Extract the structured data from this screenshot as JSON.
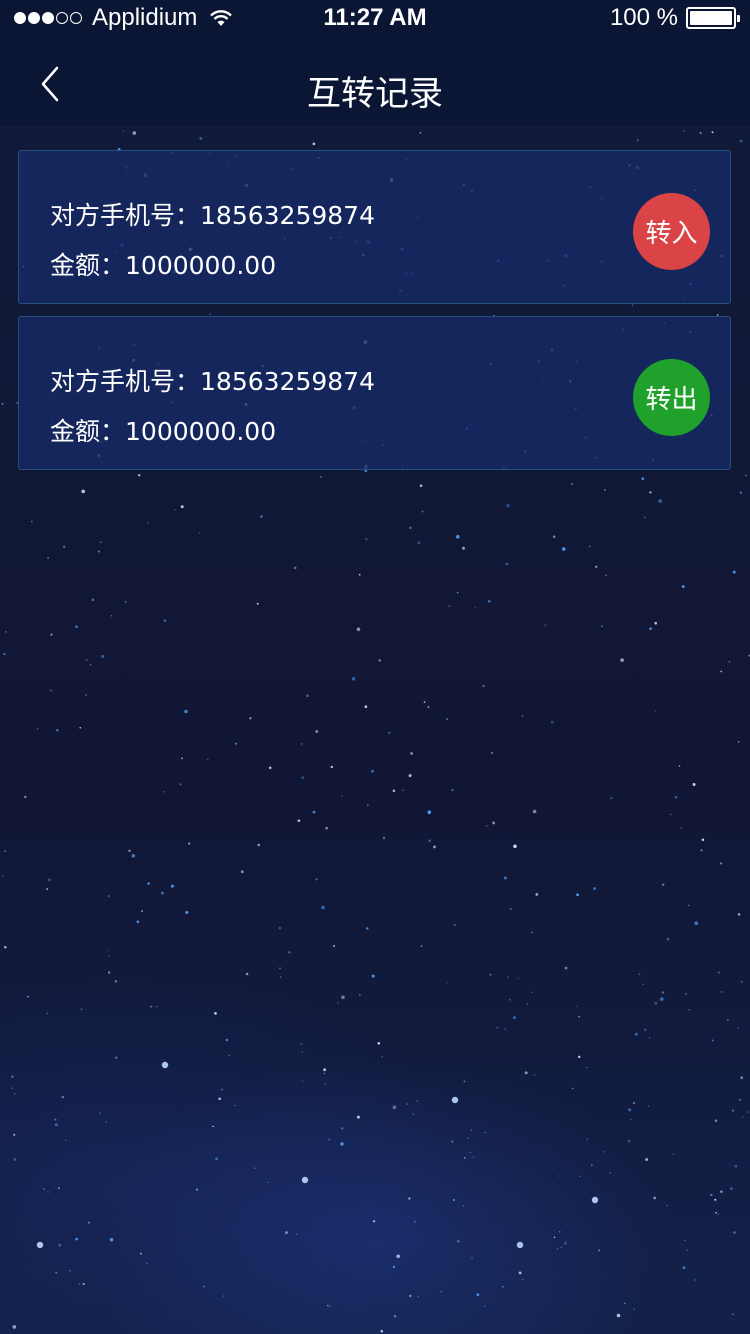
{
  "status_bar": {
    "carrier": "Applidium",
    "time": "11:27 AM",
    "battery_text": "100 %",
    "signal_bars_filled": 3,
    "signal_bars_total": 5,
    "battery_level": 1.0,
    "wifi_icon": "wifi-icon",
    "battery_icon": "battery-icon"
  },
  "nav": {
    "title": "互转记录",
    "back_icon": "chevron-left-icon"
  },
  "records": [
    {
      "phone_label": "对方手机号：",
      "phone": "18563259874",
      "amount_label": "金额：",
      "amount": "1000000.00",
      "badge_label": "转入",
      "badge_color": "#db4446"
    },
    {
      "phone_label": "对方手机号：",
      "phone": "18563259874",
      "amount_label": "金额：",
      "amount": "1000000.00",
      "badge_label": "转出",
      "badge_color": "#1fa12b"
    }
  ],
  "colors": {
    "header_bg": "#0b1634",
    "page_bg": "#111836",
    "card_bg": "#162a66",
    "card_border": "#24507e"
  }
}
